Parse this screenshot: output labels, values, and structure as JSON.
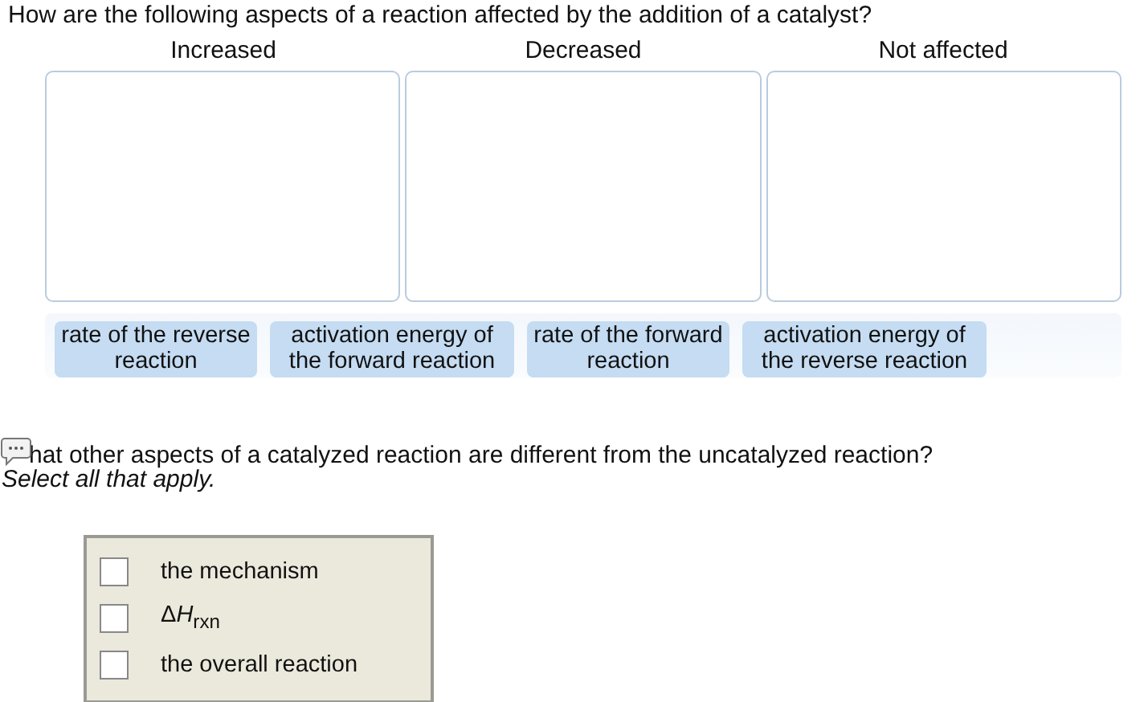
{
  "question": "How are the following aspects of a reaction affected by the addition of a catalyst?",
  "bins": [
    {
      "label": "Increased"
    },
    {
      "label": "Decreased"
    },
    {
      "label": "Not affected"
    }
  ],
  "chips": [
    "rate of the reverse reaction",
    "activation energy of the forward reaction",
    "rate of the forward reaction",
    "activation energy of the reverse reaction"
  ],
  "question2": "hat other aspects of a catalyzed reaction are different from the uncatalyzed reaction?",
  "instruction": "Select all that apply.",
  "options": [
    {
      "label": "the mechanism",
      "checked": false
    },
    {
      "prefix": "Δ",
      "label": "*H*$_{rxn}$",
      "checked": false
    },
    {
      "label": "the overall reaction",
      "checked": false
    }
  ]
}
